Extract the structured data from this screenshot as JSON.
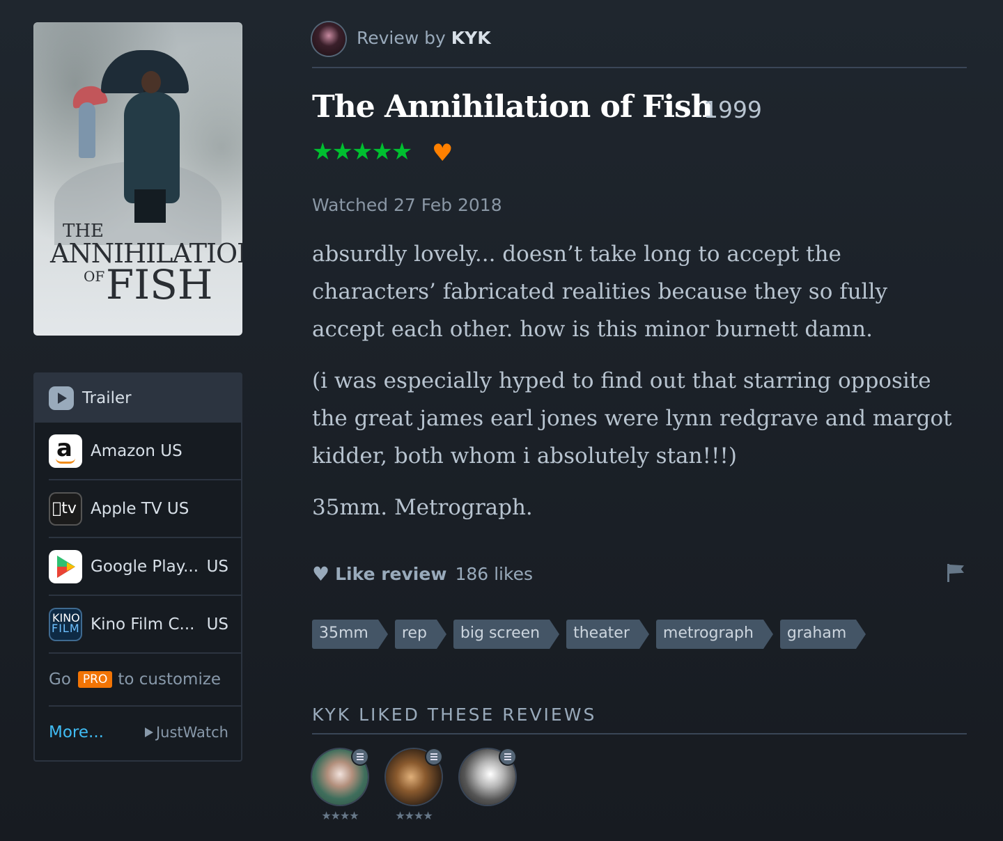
{
  "poster": {
    "line1": "THE",
    "line2": "ANNIHILATION",
    "line3": "OF",
    "line4": "FISH"
  },
  "services": {
    "trailer_label": "Trailer",
    "items": [
      {
        "name": "Amazon US",
        "country": "",
        "icon": "amazon-icon"
      },
      {
        "name": "Apple TV US",
        "country": "",
        "icon": "apple-tv-icon"
      },
      {
        "name": "Google Play...",
        "country": "US",
        "icon": "google-play-icon"
      },
      {
        "name": "Kino Film C...",
        "country": "US",
        "icon": "kino-film-icon"
      }
    ],
    "pro_prefix": "Go",
    "pro_badge": "PRO",
    "pro_suffix": "to customize",
    "more_label": "More...",
    "justwatch_label": "JustWatch",
    "logo_text": {
      "amazon": "a",
      "apple": "tv",
      "kino_1": "KINO",
      "kino_2": "FILM"
    }
  },
  "header": {
    "byline_prefix": "Review by",
    "username": "KYK"
  },
  "film": {
    "title": "The Annihilation of Fish",
    "year": "1999",
    "stars": "★★★★★",
    "rating": 5,
    "liked": true,
    "heart": "♥"
  },
  "watched": "Watched 27 Feb 2018",
  "review": {
    "paragraphs": [
      "absurdly lovely... doesn’t take long to accept the characters’ fabricated realities because they so fully accept each other. how is this minor burnett damn.",
      "(i was especially hyped to find out that starring opposite the great james earl jones were lynn redgrave and margot kidder, both whom i absolutely stan!!!)",
      "35mm. Metrograph."
    ]
  },
  "likes": {
    "label": "Like review",
    "count_text": "186 likes",
    "heart": "♥"
  },
  "tags": [
    "35mm",
    "rep",
    "big screen",
    "theater",
    "metrograph",
    "graham"
  ],
  "liked_reviews": {
    "title": "KYK LIKED THESE REVIEWS",
    "items": [
      {
        "stars": "★★★★"
      },
      {
        "stars": "★★★★"
      },
      {
        "stars": ""
      }
    ]
  },
  "colors": {
    "background": "#1f262e",
    "star_green": "#00c030",
    "heart_orange": "#ff8000",
    "link_blue": "#40bcf4",
    "pro_orange": "#f27405",
    "tag_bg": "#445566"
  }
}
